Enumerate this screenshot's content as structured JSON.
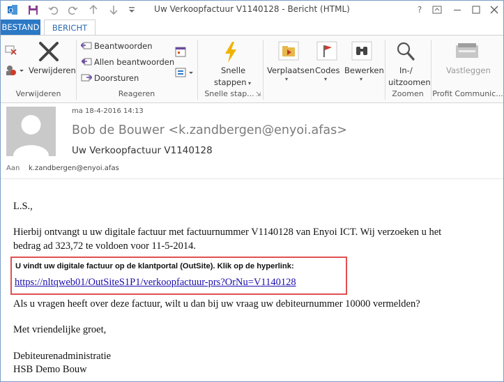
{
  "window": {
    "title": "Uw Verkoopfactuur V1140128 - Bericht (HTML)",
    "help": "?",
    "controls": [
      "restore",
      "minimize",
      "maximize",
      "close"
    ]
  },
  "quick_access": [
    "save-icon",
    "undo-icon",
    "redo-icon",
    "up-icon",
    "down-icon",
    "customize-icon"
  ],
  "tabs": [
    {
      "label": "BESTAND"
    },
    {
      "label": "BERICHT"
    }
  ],
  "ribbon": {
    "groups": {
      "delete": {
        "label": "Verwijderen",
        "delete_button": "Verwijderen"
      },
      "respond": {
        "label": "Reageren",
        "reply": "Beantwoorden",
        "reply_all": "Allen beantwoorden",
        "forward": "Doorsturen"
      },
      "quick_steps": {
        "label": "Snelle stap...",
        "button_line1": "Snelle",
        "button_line2": "stappen"
      },
      "move": {
        "move_button": "Verplaatsen"
      },
      "tags": {
        "codes_button": "Codes"
      },
      "editing": {
        "edit_button": "Bewerken"
      },
      "zoom": {
        "label": "Zoomen",
        "button_line1": "In-/",
        "button_line2": "uitzoomen"
      },
      "profit": {
        "label": "Profit Communic...",
        "button": "Vastleggen"
      }
    }
  },
  "message": {
    "date": "ma 18-4-2016 14:13",
    "from": "Bob de Bouwer <k.zandbergen@enyoi.afas>",
    "subject": "Uw Verkoopfactuur V1140128",
    "to_label": "Aan",
    "to": "k.zandbergen@enyoi.afas"
  },
  "body": {
    "greeting": "L.S.,",
    "para1_line1": "Hierbij ontvangt u uw digitale factuur met factuurnummer V1140128 van Enyoi ICT. Wij verzoeken u het",
    "para1_line2": "bedrag ad 323,72 te voldoen voor 11-5-2014.",
    "highlight_text": "U vindt uw digitale factuur op de klantportal (OutSite). Klik op de hyperlink:",
    "link": "https://nltqweb01/OutSiteS1P1/verkoopfactuur-prs?OrNu=V1140128",
    "question": "Als u vragen heeft over deze factuur, wilt u dan bij uw vraag uw debiteurnummer 10000 vermelden?",
    "closing": "Met vriendelijke groet,",
    "sig_line1": "Debiteurenadministratie",
    "sig_line2": "HSB Demo Bouw"
  },
  "colors": {
    "accent": "#2b78c5",
    "highlight_border": "#e05050",
    "link": "#1a0dab"
  }
}
